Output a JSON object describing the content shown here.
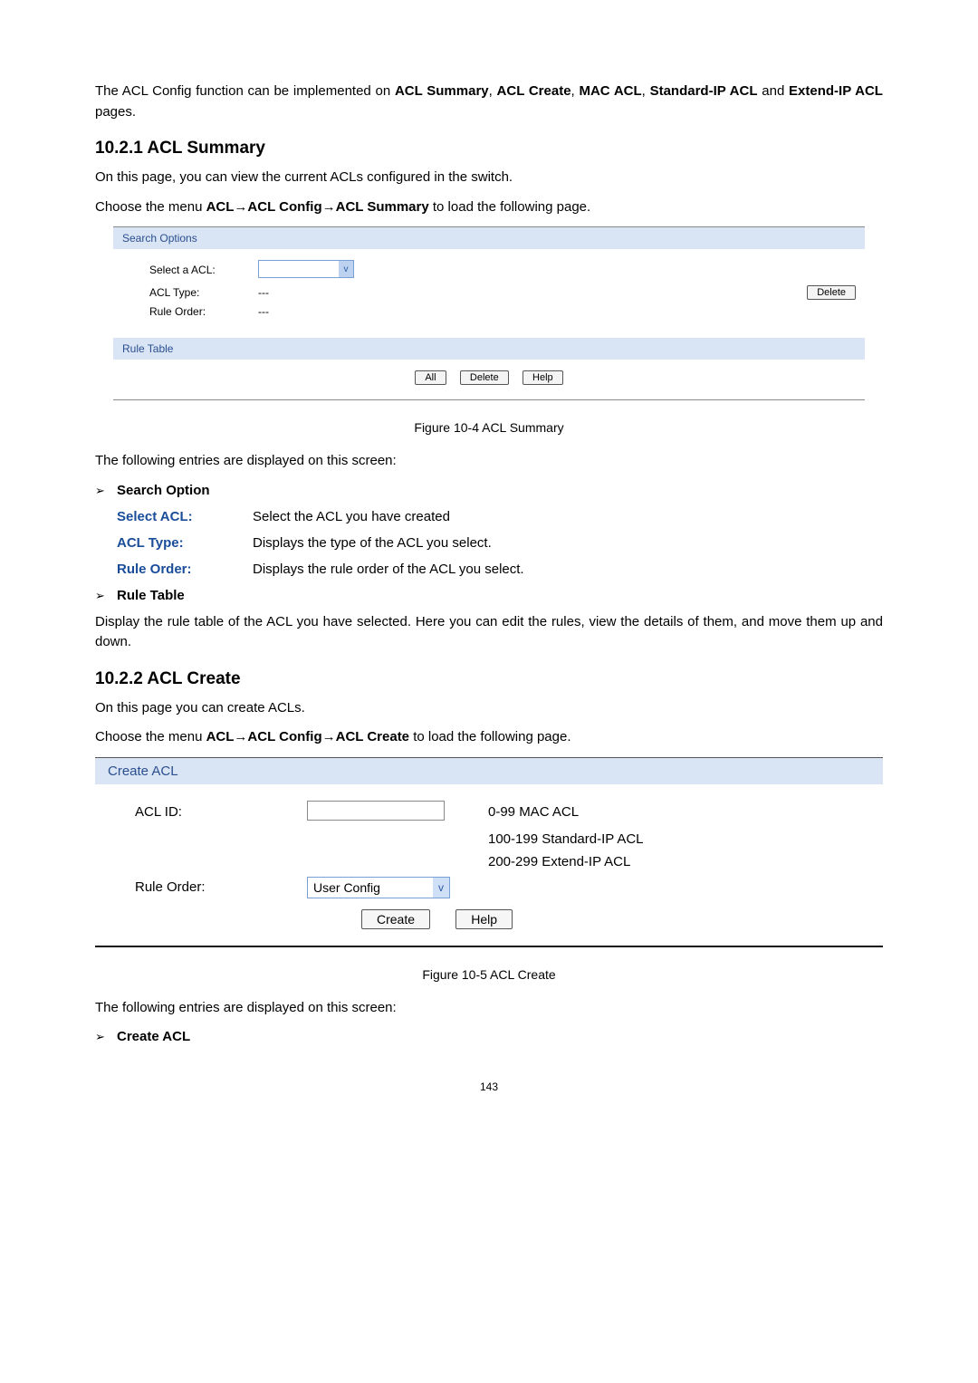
{
  "intro": {
    "pre": "The ACL Config function can be implemented on ",
    "b1": "ACL Summary",
    "sep1": ", ",
    "b2": "ACL Create",
    "sep2": ", ",
    "b3": "MAC ACL",
    "sep3": ", ",
    "b4": "Standard-IP ACL",
    "and": " and ",
    "b5": "Extend-IP ACL",
    "post": " pages."
  },
  "s1": {
    "heading": "10.2.1  ACL Summary",
    "p1": "On this page, you can view the current ACLs configured in the switch.",
    "p2_pre": "Choose the menu ",
    "p2_bold": "ACL→ACL Config→ACL Summary",
    "p2_post": " to load the following page."
  },
  "shot1": {
    "hdr1": "Search Options",
    "row1_label": "Select a ACL:",
    "row2_label": "ACL Type:",
    "row2_val": "---",
    "row3_label": "Rule Order:",
    "row3_val": "---",
    "delete": "Delete",
    "hdr2": "Rule Table",
    "btn_all": "All",
    "btn_delete": "Delete",
    "btn_help": "Help"
  },
  "fig1": "Figure 10-4 ACL Summary",
  "entries_line": "The following entries are displayed on this screen:",
  "search_option_label": "Search Option",
  "defs": {
    "r1_term": "Select ACL:",
    "r1_desc": "Select the ACL you have created",
    "r2_term": "ACL Type:",
    "r2_desc": "Displays the type of the ACL you select.",
    "r3_term": "Rule Order:",
    "r3_desc": "Displays the rule order of the ACL you select."
  },
  "rule_table_label": "Rule Table",
  "rule_table_para": "Display the rule table of the ACL you have selected. Here you can edit the rules, view the details of them, and move them up and down.",
  "s2": {
    "heading": "10.2.2  ACL Create",
    "p1": "On this page you can create ACLs.",
    "p2_pre": "Choose the menu ",
    "p2_bold": "ACL→ACL Config→ACL Create",
    "p2_post": " to load the following page."
  },
  "shot2": {
    "hdr": "Create ACL",
    "row1_label": "ACL ID:",
    "hint1": "0-99 MAC ACL",
    "hint2": "100-199 Standard-IP ACL",
    "hint3": "200-299 Extend-IP ACL",
    "row2_label": "Rule Order:",
    "row2_val": "User Config",
    "btn_create": "Create",
    "btn_help": "Help"
  },
  "fig2": "Figure 10-5 ACL Create",
  "create_acl_label": "Create ACL",
  "pagenum": "143"
}
